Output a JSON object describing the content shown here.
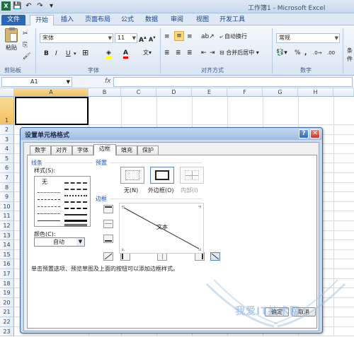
{
  "window": {
    "title": "工作簿1 - Microsoft Excel"
  },
  "ribbon_tabs": [
    "文件",
    "开始",
    "插入",
    "页面布局",
    "公式",
    "数据",
    "审阅",
    "视图",
    "开发工具"
  ],
  "ribbon": {
    "paste_label": "粘贴",
    "clipboard_group": "剪贴板",
    "font_name": "宋体",
    "font_size": "11",
    "font_group": "字体",
    "bold": "B",
    "italic": "I",
    "underline": "U",
    "wrap_text": "自动换行",
    "merge_center": "合并后居中",
    "align_group": "对齐方式",
    "number_format": "常规",
    "number_group": "数字",
    "cond_format": "条件"
  },
  "formula_bar": {
    "name_box": "A1",
    "fx": "fx",
    "value": ""
  },
  "columns": [
    "A",
    "B",
    "C",
    "D",
    "E",
    "F",
    "G",
    "H"
  ],
  "rows": [
    "1",
    "2",
    "3",
    "4",
    "5",
    "6",
    "7",
    "8",
    "9",
    "10",
    "11",
    "12",
    "13",
    "14",
    "15",
    "16",
    "17",
    "18",
    "19",
    "20",
    "21",
    "22",
    "23"
  ],
  "dialog": {
    "title": "设置单元格格式",
    "tabs": [
      "数字",
      "对齐",
      "字体",
      "边框",
      "填充",
      "保护"
    ],
    "active_tab": "边框",
    "line_section": "线条",
    "style_label": "样式(S):",
    "style_none": "无",
    "color_label": "颜色(C):",
    "color_value": "自动",
    "presets_section": "预置",
    "presets": [
      "无(N)",
      "外边框(O)",
      "内部(I)"
    ],
    "border_section": "边框",
    "preview_text": "文本",
    "hint": "单击预置选项、预览草图及上面的按钮可以添加边框样式。",
    "ok": "确定",
    "cancel": "取消"
  },
  "watermark": {
    "text": "我爱IT技术网",
    "color": "#78aadc"
  }
}
